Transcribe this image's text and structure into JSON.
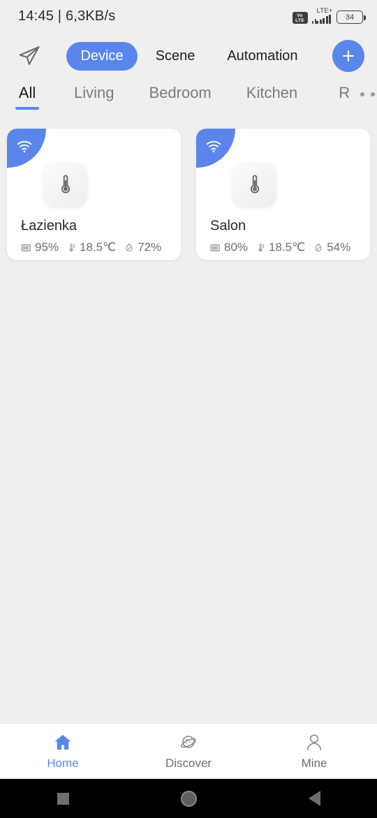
{
  "status_bar": {
    "time_and_net": "14:45 | 6,3KB/s",
    "volte_top": "Vo",
    "volte_bottom": "LTE",
    "network_type": "LTE+",
    "battery_level": "34"
  },
  "header": {
    "send_icon": "paper-plane-icon",
    "tabs": [
      {
        "label": "Device",
        "active": true
      },
      {
        "label": "Scene",
        "active": false
      },
      {
        "label": "Automation",
        "active": false
      }
    ],
    "add_button": "+"
  },
  "room_tabs": {
    "items": [
      {
        "label": "All",
        "active": true
      },
      {
        "label": "Living",
        "active": false
      },
      {
        "label": "Bedroom",
        "active": false
      },
      {
        "label": "Kitchen",
        "active": false
      },
      {
        "label": "R",
        "active": false
      }
    ]
  },
  "devices": [
    {
      "name": "Łazienka",
      "connection_icon": "wifi-icon",
      "device_icon": "thermometer-icon",
      "battery": "95%",
      "temperature": "18.5℃",
      "humidity": "72%"
    },
    {
      "name": "Salon",
      "connection_icon": "wifi-icon",
      "device_icon": "thermometer-icon",
      "battery": "80%",
      "temperature": "18.5℃",
      "humidity": "54%"
    }
  ],
  "bottom_nav": [
    {
      "label": "Home",
      "icon": "home-icon",
      "active": true
    },
    {
      "label": "Discover",
      "icon": "planet-icon",
      "active": false
    },
    {
      "label": "Mine",
      "icon": "person-icon",
      "active": false
    }
  ],
  "android_nav": {
    "recents": "square",
    "home": "circle",
    "back": "triangle-left"
  },
  "colors": {
    "accent": "#5a86ec",
    "background": "#efefef",
    "card": "#ffffff",
    "text_primary": "#2a2a2a",
    "text_secondary": "#6f6f6f"
  }
}
